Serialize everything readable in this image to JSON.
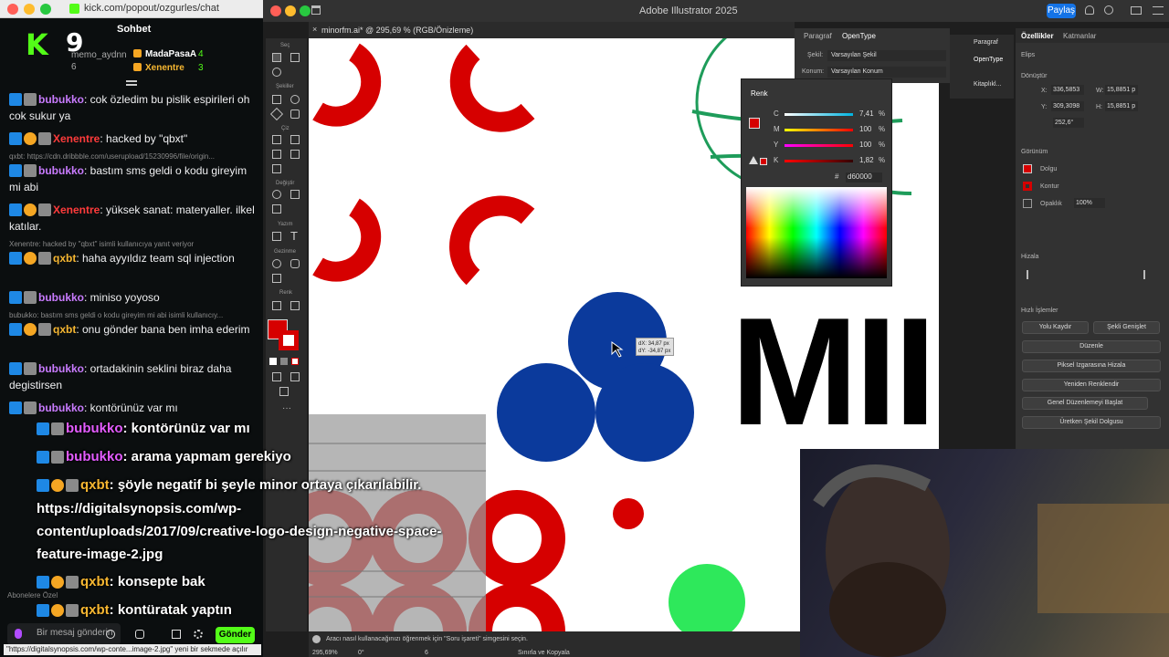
{
  "chat": {
    "url": "kick.com/popout/ozgurles/chat",
    "title": "Sohbet",
    "logo": "K",
    "viewers": "9",
    "leaderboard": [
      {
        "name": "memo_aydnn",
        "count": "6"
      },
      {
        "name": "MadaPasaA",
        "count": "4"
      },
      {
        "name": "Xenentre",
        "count": "3"
      }
    ],
    "messages": [
      {
        "user": "bubukko",
        "color": "#c97bff",
        "text": ": cok özledim bu pislik espirileri oh cok sukur ya"
      },
      {
        "user": "Xenentre",
        "color": "#ff3b3b",
        "text": ": hacked by \"qbxt\""
      },
      {
        "reply": "qxbt: https://cdn.dribbble.com/userupload/15230996/file/origin..."
      },
      {
        "user": "bubukko",
        "color": "#c97bff",
        "text": ": bastım sms geldi o kodu gireyim mi abi"
      },
      {
        "user": "Xenentre",
        "color": "#ff3b3b",
        "text": ": yüksek sanat: materyaller. ilkel katılar."
      },
      {
        "reply": "Xenentre: hacked by \"qbxt\" isimli kullanıcıya yanıt veriyor"
      },
      {
        "user": "qxbt",
        "color": "#f7b731",
        "text": ": haha ayyıldız team sql injection"
      },
      {
        "user": "bubukko",
        "color": "#c97bff",
        "text": ": miniso yoyoso"
      },
      {
        "reply": "bubukko: bastım sms geldi o kodu gireyim mi abi isimli kullanıcıy..."
      },
      {
        "user": "qxbt",
        "color": "#f7b731",
        "text": ": onu gönder bana ben imha ederim"
      },
      {
        "user": "bubukko",
        "color": "#c97bff",
        "text": ": ortadakinin seklini biraz daha degistirsen"
      },
      {
        "user": "bubukko",
        "color": "#c97bff",
        "text": ": kontörünüz var mı"
      }
    ],
    "input_placeholder": "Bir mesaj gönderin",
    "send_label": "Gönder",
    "subscribers_label": "Abonelere Özel",
    "status_url": "\"https://digitalsynopsis.com/wp-conte...image-2.jpg\" yeni bir sekmede açılır"
  },
  "overlay": [
    {
      "user": "bubukko",
      "text": ": kontörünüz var mı"
    },
    {
      "user": "bubukko",
      "text": ": arama yapmam gerekiyo"
    },
    {
      "user": "qxbt",
      "text": ": şöyle negatif bi şeyle minor ortaya çıkarılabilir."
    },
    {
      "text": "https://digitalsynopsis.com/wp-"
    },
    {
      "text": "content/uploads/2017/09/creative-logo-design-negative-space-"
    },
    {
      "text": "feature-image-2.jpg"
    },
    {
      "user": "qxbt",
      "text": ": konsepte bak"
    },
    {
      "user": "qxbt",
      "text": ": kontüratak yaptın"
    }
  ],
  "illustrator": {
    "app_title": "Adobe Illustrator 2025",
    "share_label": "Paylaş",
    "doc_tab": "minorfm.ai* @ 295,69 % (RGB/Önizleme)",
    "tool_labels": [
      "Seç",
      "Şekiller",
      "Çiz",
      "Değiştir",
      "Yazım",
      "Gezinme",
      "Renk"
    ],
    "drag_tooltip": [
      "dX: 34,87 px",
      "dY: -34,87 px"
    ],
    "canvas_text": "MII",
    "status_hint": "Aracı nasıl kullanacağınızı öğrenmek için \"Soru işareti\" simgesini seçin.",
    "zoom": "295,69%",
    "rotation": "0°",
    "artboard": "6",
    "status_mode": "Sınırla ve Kopyala",
    "type_panel": {
      "tabs": [
        "Paragraf",
        "OpenType"
      ],
      "shape_label": "Şekil:",
      "shape_value": "Varsayılan Şekil",
      "pos_label": "Konum:",
      "pos_value": "Varsayılan Konum"
    },
    "mid_panel": [
      "Paragraf",
      "OpenType",
      "Kitaplıkl..."
    ],
    "color_panel": {
      "title": "Renk",
      "sliders": [
        {
          "label": "C",
          "value": "7,41",
          "unit": "%"
        },
        {
          "label": "M",
          "value": "100",
          "unit": "%"
        },
        {
          "label": "Y",
          "value": "100",
          "unit": "%"
        },
        {
          "label": "K",
          "value": "1,82",
          "unit": "%"
        }
      ],
      "hex": "d60000"
    },
    "props": {
      "tabs": [
        "Özellikler",
        "Katmanlar"
      ],
      "object": "Elips",
      "transform_label": "Dönüştür",
      "x": "336,5853",
      "y": "309,3098",
      "w": "15,8851 p",
      "h": "15,8851 p",
      "angle": "252,6°",
      "appearance_label": "Görünüm",
      "fill_label": "Dolgu",
      "stroke_label": "Kontur",
      "opacity_label": "Opaklık",
      "opacity_value": "100%",
      "align_label": "Hizala",
      "quick_label": "Hızlı İşlemler",
      "btn_offset": "Yolu Kaydır",
      "btn_expand": "Şekli Genişlet",
      "btn_arrange": "Düzenle",
      "btn_pixel": "Piksel Izgarasına Hizala",
      "btn_recolor": "Yeniden Renklendir",
      "btn_global": "Genel Düzenlemeyi Başlat",
      "btn_genfill": "Üretken Şekil Dolgusu"
    }
  },
  "colors": {
    "kick_green": "#53fc18",
    "red": "#d60000",
    "blue": "#0b3a9c",
    "green": "#2ee85b"
  }
}
